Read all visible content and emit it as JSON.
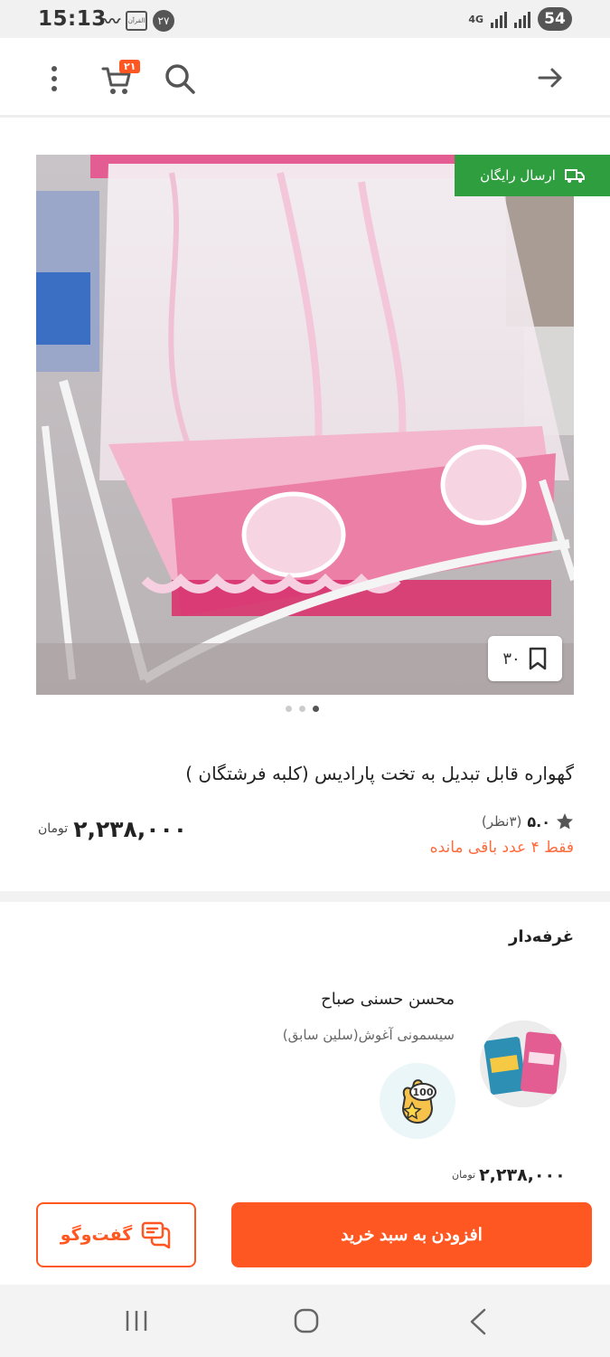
{
  "status_bar": {
    "time": "15:13",
    "notification_count": "۲۷",
    "quran_icon_text": "القرآن",
    "network": "4G",
    "battery": "54"
  },
  "app_bar": {
    "cart_count": "۲۱"
  },
  "product": {
    "free_shipping_label": "ارسال رایگان",
    "bookmark_count": "۳۰",
    "title": "گهواره قابل تبدیل به تخت پارادیس (کلبه فرشتگان )",
    "rating_score": "۵.۰",
    "rating_count": "(۳نظر)",
    "stock_text": "فقط ۴ عدد باقی مانده",
    "price": "۲,۲۳۸,۰۰۰",
    "currency": "تومان",
    "image_dots_total": 3,
    "image_dots_active": 3
  },
  "booth": {
    "section_title": "غرفه‌دار",
    "seller_name": "محسن حسنی صباح",
    "shop_name": "سیسمونی  آغوش(سلین سابق)",
    "award_badge_text": "100",
    "price": "۲,۲۳۸,۰۰۰",
    "currency": "تومان"
  },
  "actions": {
    "add_to_cart": "افزودن به سبد خرید",
    "chat": "گفت‌وگو"
  },
  "colors": {
    "accent": "#ff5722",
    "free_shipping_bg": "#2e9e3f",
    "stock_text": "#ff6b3d"
  }
}
